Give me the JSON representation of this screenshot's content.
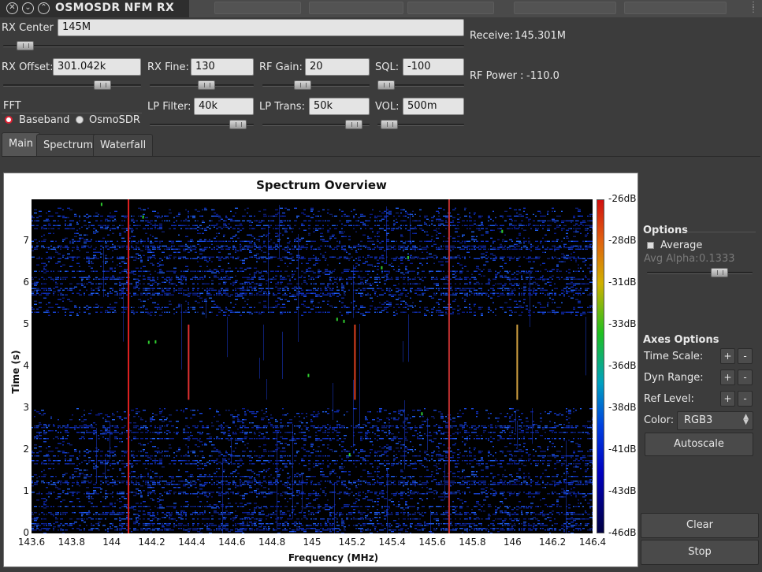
{
  "window": {
    "title": "OSMOSDR NFM RX"
  },
  "controls": {
    "rx_center": {
      "label": "RX Center :",
      "value": "145M",
      "slider": 0.03
    },
    "receive": {
      "label": "Receive:",
      "value": "145.301M"
    },
    "rx_offset": {
      "label": "RX Offset:",
      "value": "301.042k",
      "slider": 0.75
    },
    "rx_fine": {
      "label": "RX Fine:",
      "value": "130",
      "slider": 0.55
    },
    "rf_gain": {
      "label": "RF Gain:",
      "value": "20",
      "slider": 0.35
    },
    "sql": {
      "label": "SQL:",
      "value": "-100",
      "slider": 0.0
    },
    "rf_power": {
      "label": "RF Power :",
      "value": "-110.0"
    },
    "lp_filter": {
      "label": "LP Filter:",
      "value": "40k",
      "slider": 0.92
    },
    "lp_trans": {
      "label": "LP Trans:",
      "value": "50k",
      "slider": 0.92
    },
    "vol": {
      "label": "VOL:",
      "value": "500m",
      "slider": 0.05
    },
    "fft": {
      "label": "FFT",
      "options": [
        "Baseband",
        "OsmoSDR"
      ],
      "selected": "Baseband"
    }
  },
  "tabs": [
    {
      "label": "Main",
      "active": true
    },
    {
      "label": "Spectrum",
      "active": false
    },
    {
      "label": "Waterfall",
      "active": false
    }
  ],
  "plot": {
    "title": "Spectrum Overview",
    "xlabel": "Frequency (MHz)",
    "ylabel": "Time (s)",
    "xticks": [
      "143.6",
      "143.8",
      "144",
      "144.2",
      "144.4",
      "144.6",
      "144.8",
      "145",
      "145.2",
      "145.4",
      "145.6",
      "145.8",
      "146",
      "146.2",
      "146.4"
    ],
    "yticks": [
      "0",
      "1",
      "2",
      "3",
      "4",
      "5",
      "6",
      "7"
    ],
    "cticks": [
      "-26dB",
      "-28dB",
      "-31dB",
      "-33dB",
      "-36dB",
      "-38dB",
      "-41dB",
      "-43dB",
      "-46dB"
    ]
  },
  "chart_data": {
    "type": "heatmap",
    "title": "Spectrum Overview",
    "xlabel": "Frequency (MHz)",
    "ylabel": "Time (s)",
    "xlim": [
      143.6,
      146.4
    ],
    "ylim": [
      0,
      8
    ],
    "colorbar": {
      "min": "-46dB",
      "max": "-26dB",
      "colormap": "RGB3"
    },
    "strong_signals_mhz": [
      144.08,
      144.38,
      145.21,
      145.68,
      146.02
    ],
    "active_time_bands_s": [
      [
        0,
        3.0
      ],
      [
        5.2,
        7.8
      ]
    ]
  },
  "options": {
    "section": "Options",
    "average_label": "Average",
    "average_checked": false,
    "avg_alpha_label": "Avg Alpha:",
    "avg_alpha_value": "0.1333",
    "avg_alpha_slider": 0.72
  },
  "axes_options": {
    "section": "Axes Options",
    "time_scale": "Time Scale:",
    "dyn_range": "Dyn Range:",
    "ref_level": "Ref Level:",
    "plus": "+",
    "minus": "-",
    "color_label": "Color:",
    "color_value": "RGB3",
    "autoscale": "Autoscale"
  },
  "buttons": {
    "clear": "Clear",
    "stop": "Stop"
  },
  "colors": {
    "bg": "#3c3c3c",
    "radio_accent": "#dd2233"
  }
}
